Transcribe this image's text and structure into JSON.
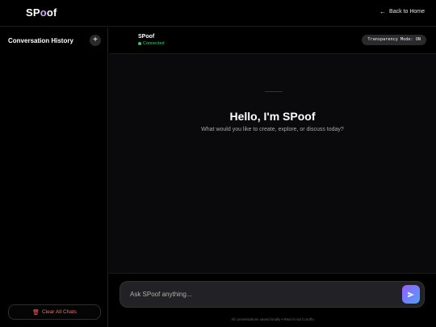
{
  "app": {
    "logo_s": "S",
    "logo_p": "P",
    "logo_o": "o",
    "logo_of": "of",
    "back_label": "Back to Home"
  },
  "sidebar": {
    "title": "Conversation History",
    "new_label": "+",
    "clear_label": "Clear All Chats"
  },
  "chat": {
    "bot_name": "SPoof",
    "status": "Connected",
    "mode_badge": "Transparency Mode: ON",
    "greeting": "Hello, I'm SPoof",
    "subtitle": "What would you like to create, explore, or discuss today?"
  },
  "composer": {
    "placeholder": "Ask SPoof anything...",
    "footer": "All conversations saved locally • Real AI via Coroflo"
  },
  "colors": {
    "accent_start": "#9b5cff",
    "accent_end": "#4aa3ff",
    "status_green": "#2ecc71",
    "danger": "#f06a6a"
  }
}
